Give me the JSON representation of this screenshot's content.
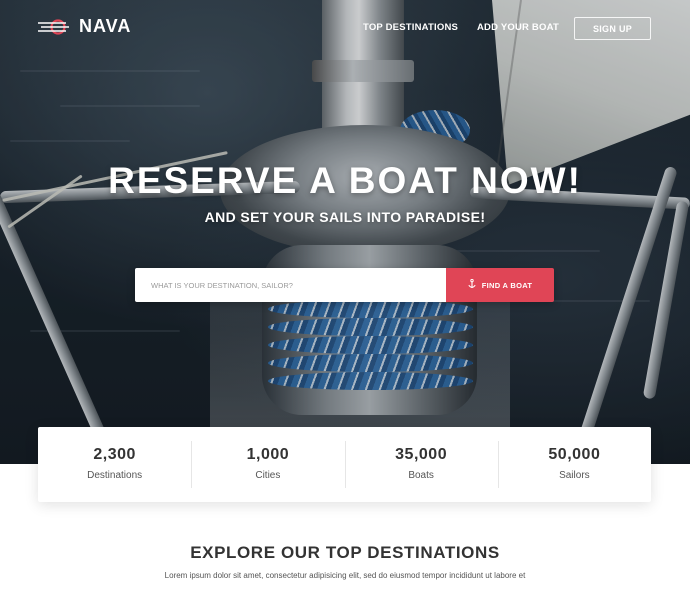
{
  "brand": {
    "name": "NAVA",
    "accent": "#e04556"
  },
  "nav": {
    "links": [
      "TOP DESTINATIONS",
      "ADD YOUR BOAT"
    ],
    "signup": "SIGN UP"
  },
  "hero": {
    "headline": "RESERVE A BOAT NOW!",
    "subline": "AND SET YOUR SAILS INTO PARADISE!"
  },
  "search": {
    "placeholder": "WHAT IS YOUR DESTINATION, SAILOR?",
    "button": "FIND A BOAT",
    "button_icon": "anchor-icon"
  },
  "stats": [
    {
      "value": "2,300",
      "label": "Destinations"
    },
    {
      "value": "1,000",
      "label": "Cities"
    },
    {
      "value": "35,000",
      "label": "Boats"
    },
    {
      "value": "50,000",
      "label": "Sailors"
    }
  ],
  "explore": {
    "title": "EXPLORE OUR TOP DESTINATIONS",
    "text": "Lorem ipsum dolor sit amet, consectetur adipisicing elit, sed do eiusmod tempor incididunt ut labore et"
  }
}
